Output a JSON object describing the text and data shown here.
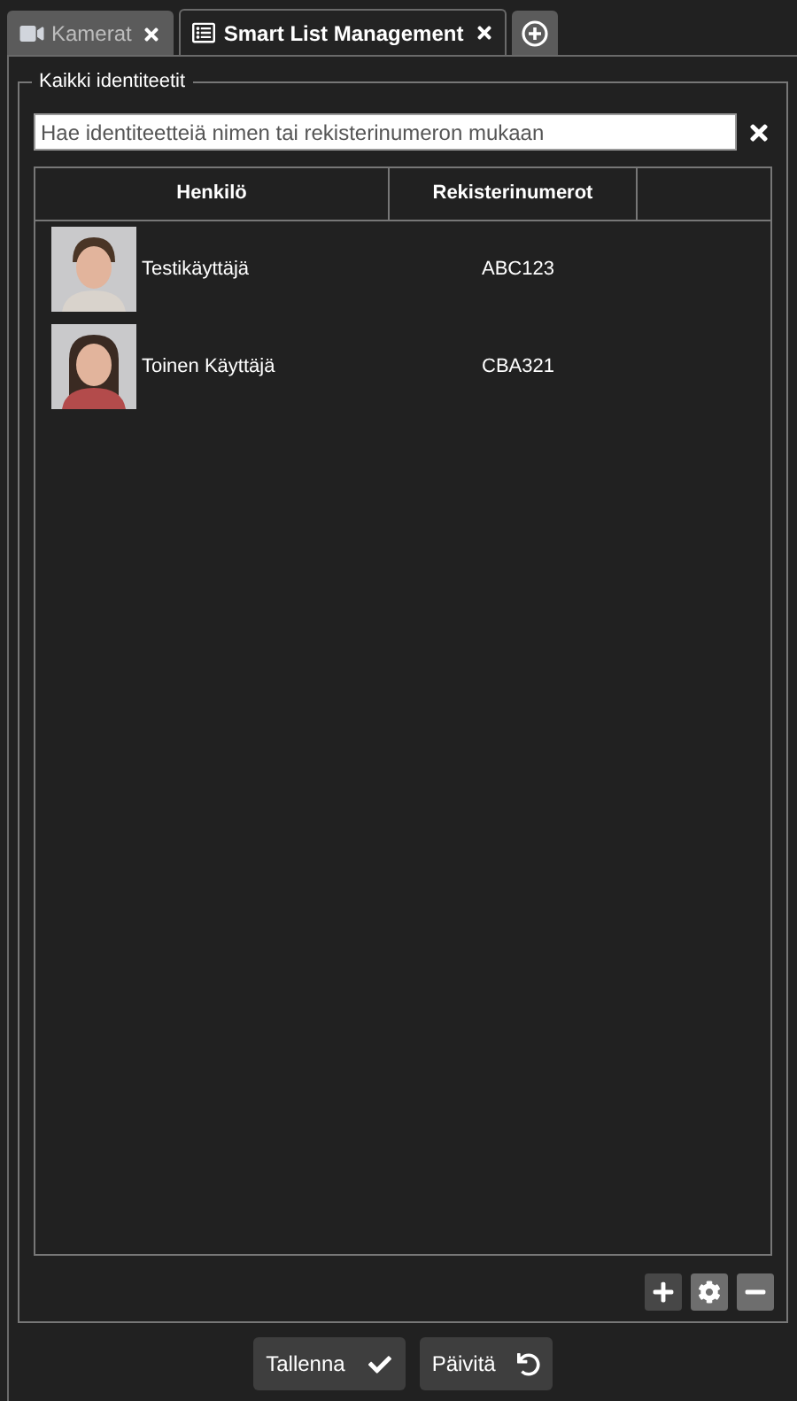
{
  "tabs": [
    {
      "label": "Kamerat",
      "kind": "camera",
      "selected": false
    },
    {
      "label": "Smart List Management",
      "kind": "list",
      "selected": true
    }
  ],
  "group": {
    "title": "Kaikki identiteetit"
  },
  "search": {
    "placeholder": "Hae identiteetteiä nimen tai rekisterinumeron mukaan"
  },
  "table": {
    "columns": [
      "Henkilö",
      "Rekisterinumerot"
    ],
    "rows": [
      {
        "name": "Testikäyttäjä",
        "plates": "ABC123"
      },
      {
        "name": "Toinen Käyttäjä",
        "plates": "CBA321"
      }
    ]
  },
  "actions": [
    {
      "kind": "add",
      "disabled": false
    },
    {
      "kind": "settings",
      "disabled": true
    },
    {
      "kind": "remove",
      "disabled": true
    }
  ],
  "buttons": [
    {
      "label": "Tallenna",
      "kind": "save"
    },
    {
      "label": "Päivitä",
      "kind": "refresh"
    }
  ]
}
